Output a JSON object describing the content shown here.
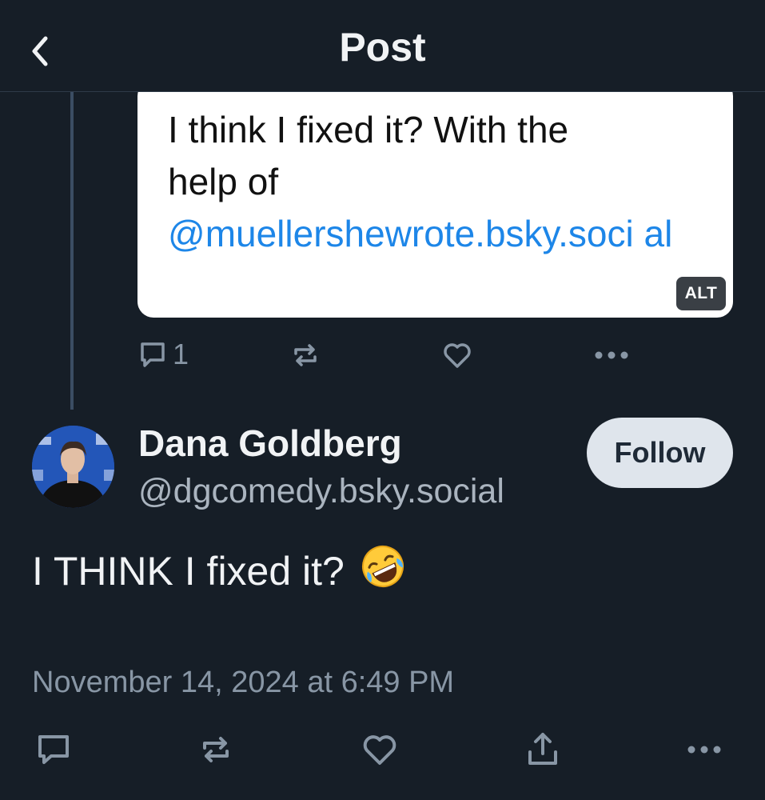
{
  "header": {
    "title": "Post"
  },
  "parent_post": {
    "image_text_line1": "I think I fixed it? With the",
    "image_text_line2": "help of",
    "image_mention": "@muellershewrote.bsky.soci al",
    "alt_badge": "ALT",
    "reply_count": "1"
  },
  "main_post": {
    "author_name": "Dana Goldberg",
    "author_handle": "@dgcomedy.bsky.social",
    "follow_label": "Follow",
    "text": "I THINK I fixed it?",
    "emoji": "rolling-on-floor-laughing-emoji",
    "timestamp": "November 14, 2024 at 6:49 PM"
  },
  "colors": {
    "background": "#161e27",
    "mention": "#1d86e8",
    "muted": "#8896a5",
    "follow_bg": "#dfe5ec"
  }
}
